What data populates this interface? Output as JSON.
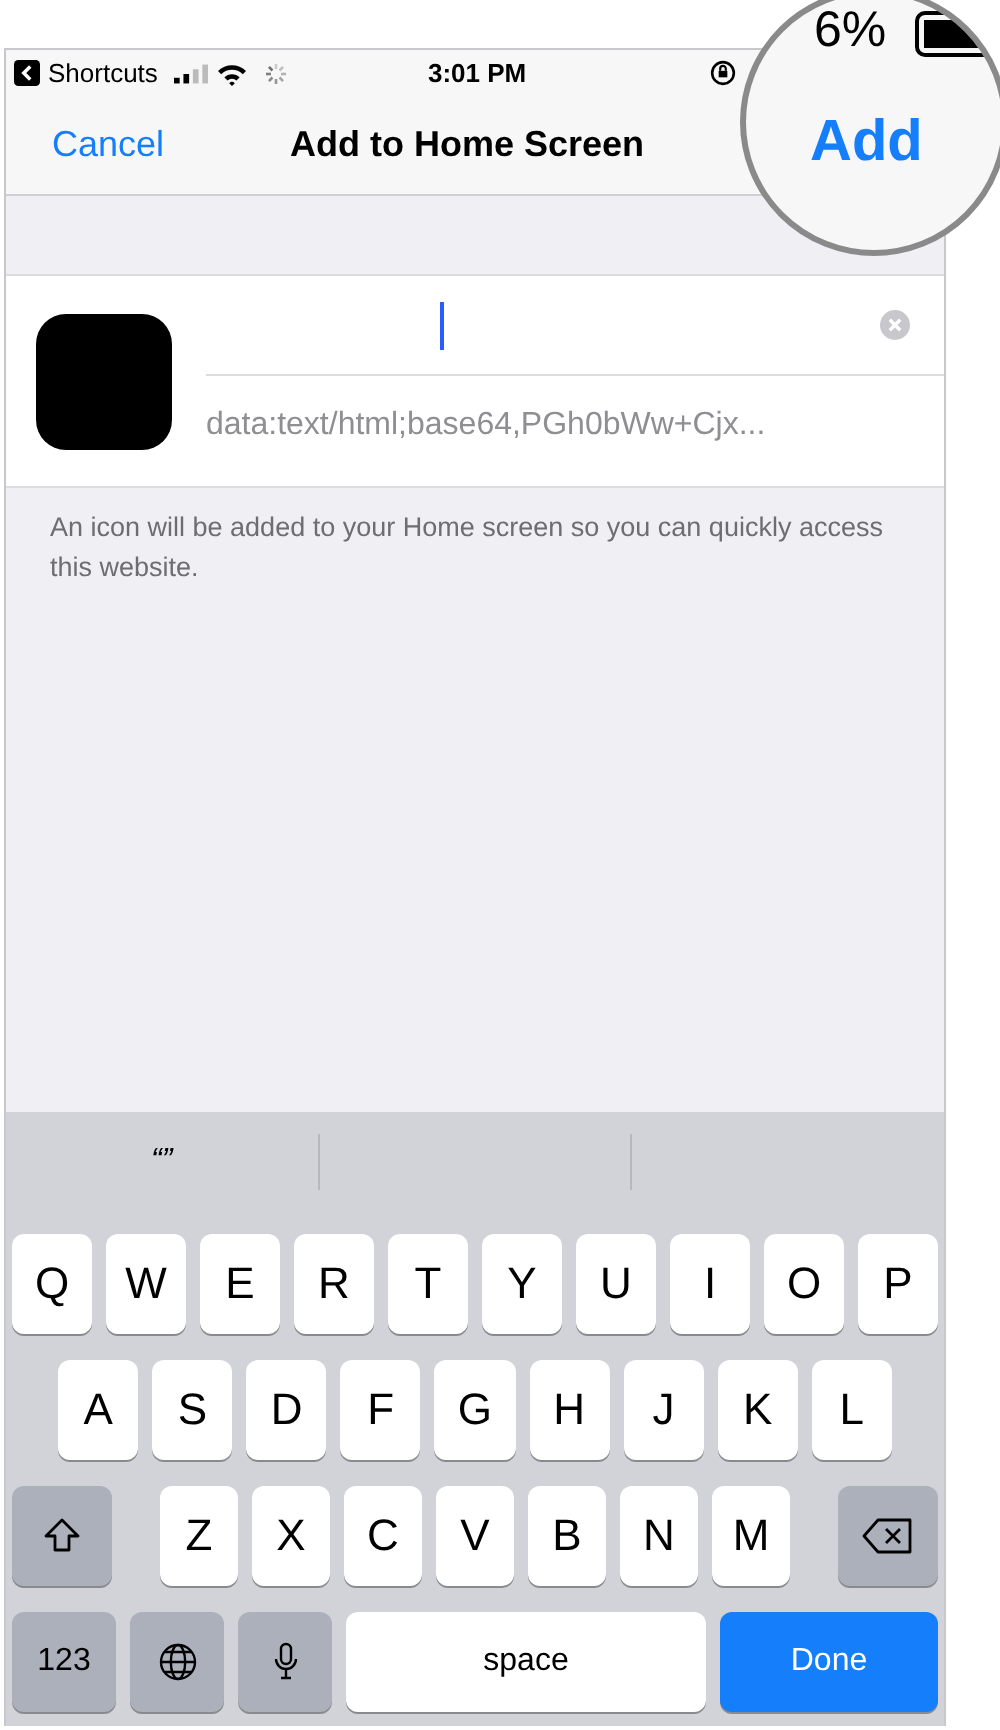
{
  "status_bar": {
    "back_label": "Shortcuts",
    "time": "3:01 PM",
    "battery": "6%"
  },
  "nav": {
    "cancel": "Cancel",
    "title": "Add to Home Screen",
    "add": "Add"
  },
  "form": {
    "url": "data:text/html;base64,PGh0bWw+Cjx...",
    "footer": "An icon will be added to your Home screen so you can quickly access this website."
  },
  "keyboard": {
    "suggestions": [
      "“”"
    ],
    "rows": [
      [
        "Q",
        "W",
        "E",
        "R",
        "T",
        "Y",
        "U",
        "I",
        "O",
        "P"
      ],
      [
        "A",
        "S",
        "D",
        "F",
        "G",
        "H",
        "J",
        "K",
        "L"
      ],
      [
        "Z",
        "X",
        "C",
        "V",
        "B",
        "N",
        "M"
      ]
    ],
    "bottom": [
      {
        "kind": "mode",
        "label": "123"
      },
      {
        "kind": "globe"
      },
      {
        "kind": "mic"
      },
      {
        "kind": "space",
        "label": "space"
      },
      {
        "kind": "done",
        "label": "Done"
      }
    ]
  }
}
